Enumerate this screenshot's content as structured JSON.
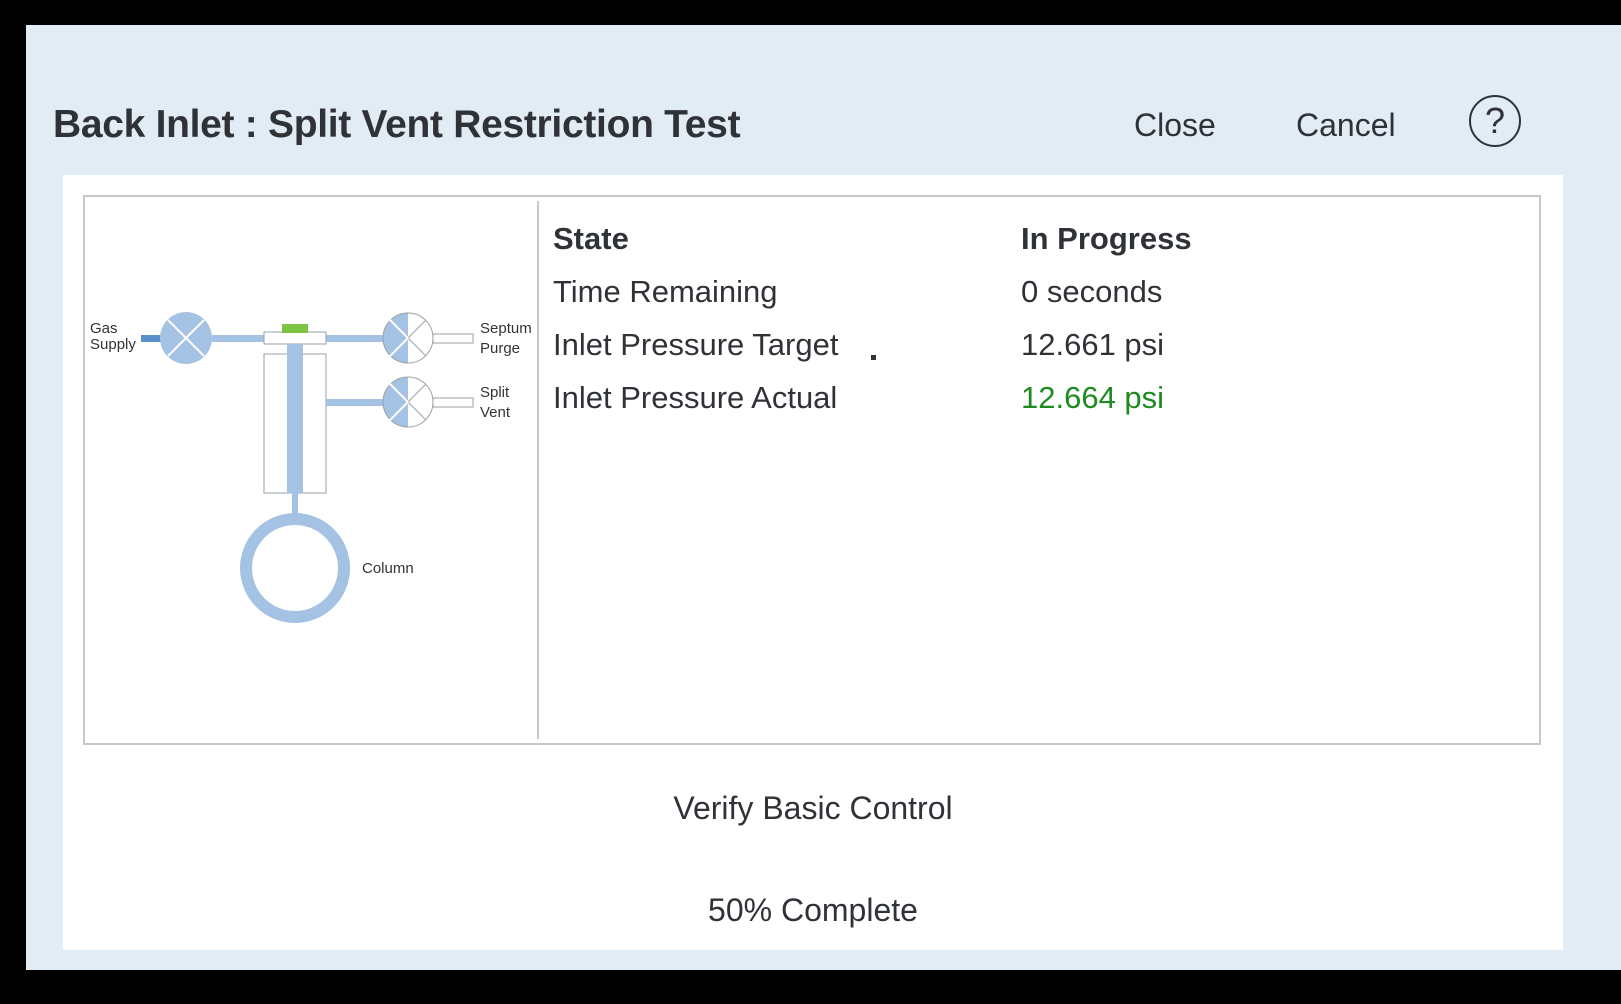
{
  "dialog": {
    "title": "Back Inlet : Split Vent Restriction Test",
    "close_label": "Close",
    "cancel_label": "Cancel",
    "help_symbol": "?"
  },
  "diagram": {
    "labels": {
      "gas_supply_line1": "Gas",
      "gas_supply_line2": "Supply",
      "septum_purge_line1": "Septum",
      "septum_purge_line2": "Purge",
      "split_vent_line1": "Split",
      "split_vent_line2": "Vent",
      "column": "Column"
    },
    "colors": {
      "pipe": "#a4c2e3",
      "valve": "#a4c2e3",
      "septum": "#7dc442",
      "outline": "#9aa0a6"
    }
  },
  "status": {
    "rows": [
      {
        "label": "State",
        "value": "In Progress"
      },
      {
        "label": "Time Remaining",
        "value": "0 seconds"
      },
      {
        "label": "Inlet Pressure Target",
        "value": "12.661 psi"
      },
      {
        "label": "Inlet Pressure Actual",
        "value": "12.664 psi"
      }
    ],
    "ok_color": "#1f8a1f"
  },
  "step": {
    "name": "Verify Basic Control",
    "progress_text": "50% Complete",
    "progress_percent": 50
  }
}
